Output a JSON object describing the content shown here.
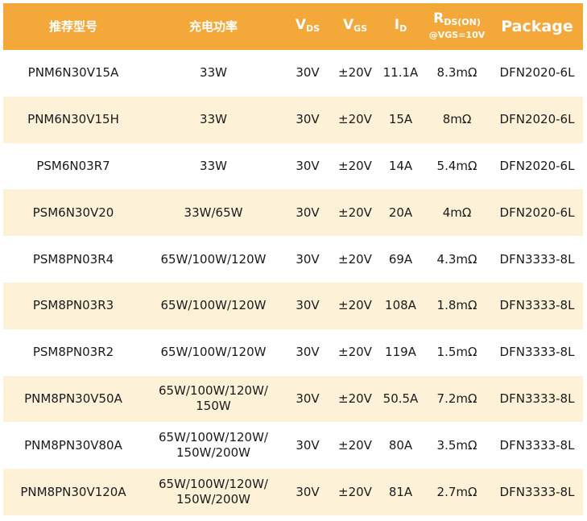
{
  "header": {
    "model": "推荐型号",
    "power": "充电功率",
    "vds": {
      "symbol": "V",
      "sub": "DS"
    },
    "vgs": {
      "symbol": "V",
      "sub": "GS"
    },
    "id": {
      "symbol": "I",
      "sub": "D"
    },
    "rds": {
      "symbol": "R",
      "sub": "DS(ON)",
      "cond": "@VGS=10V"
    },
    "package": "Package"
  },
  "rows": [
    {
      "model": "PNM6N30V15A",
      "power": [
        "33W"
      ],
      "vds": "30V",
      "vgs": "±20V",
      "id": "11.1A",
      "rds": "8.3mΩ",
      "package": "DFN2020-6L"
    },
    {
      "model": "PNM6N30V15H",
      "power": [
        "33W"
      ],
      "vds": "30V",
      "vgs": "±20V",
      "id": "15A",
      "rds": "8mΩ",
      "package": "DFN2020-6L"
    },
    {
      "model": "PSM6N03R7",
      "power": [
        "33W"
      ],
      "vds": "30V",
      "vgs": "±20V",
      "id": "14A",
      "rds": "5.4mΩ",
      "package": "DFN2020-6L"
    },
    {
      "model": "PSM6N30V20",
      "power": [
        "33W/65W"
      ],
      "vds": "30V",
      "vgs": "±20V",
      "id": "20A",
      "rds": "4mΩ",
      "package": "DFN2020-6L"
    },
    {
      "model": "PSM8PN03R4",
      "power": [
        "65W/100W/120W"
      ],
      "vds": "30V",
      "vgs": "±20V",
      "id": "69A",
      "rds": "4.3mΩ",
      "package": "DFN3333-8L"
    },
    {
      "model": "PSM8PN03R3",
      "power": [
        "65W/100W/120W"
      ],
      "vds": "30V",
      "vgs": "±20V",
      "id": "108A",
      "rds": "1.8mΩ",
      "package": "DFN3333-8L"
    },
    {
      "model": "PSM8PN03R2",
      "power": [
        "65W/100W/120W"
      ],
      "vds": "30V",
      "vgs": "±20V",
      "id": "119A",
      "rds": "1.5mΩ",
      "package": "DFN3333-8L"
    },
    {
      "model": "PNM8PN30V50A",
      "power": [
        "65W/100W/120W/",
        "150W"
      ],
      "vds": "30V",
      "vgs": "±20V",
      "id": "50.5A",
      "rds": "7.2mΩ",
      "package": "DFN3333-8L"
    },
    {
      "model": "PNM8PN30V80A",
      "power": [
        "65W/100W/120W/",
        "150W/200W"
      ],
      "vds": "30V",
      "vgs": "±20V",
      "id": "80A",
      "rds": "3.5mΩ",
      "package": "DFN3333-8L"
    },
    {
      "model": "PNM8PN30V120A",
      "power": [
        "65W/100W/120W/",
        "150W/200W"
      ],
      "vds": "30V",
      "vgs": "±20V",
      "id": "81A",
      "rds": "2.7mΩ",
      "package": "DFN3333-8L"
    }
  ]
}
